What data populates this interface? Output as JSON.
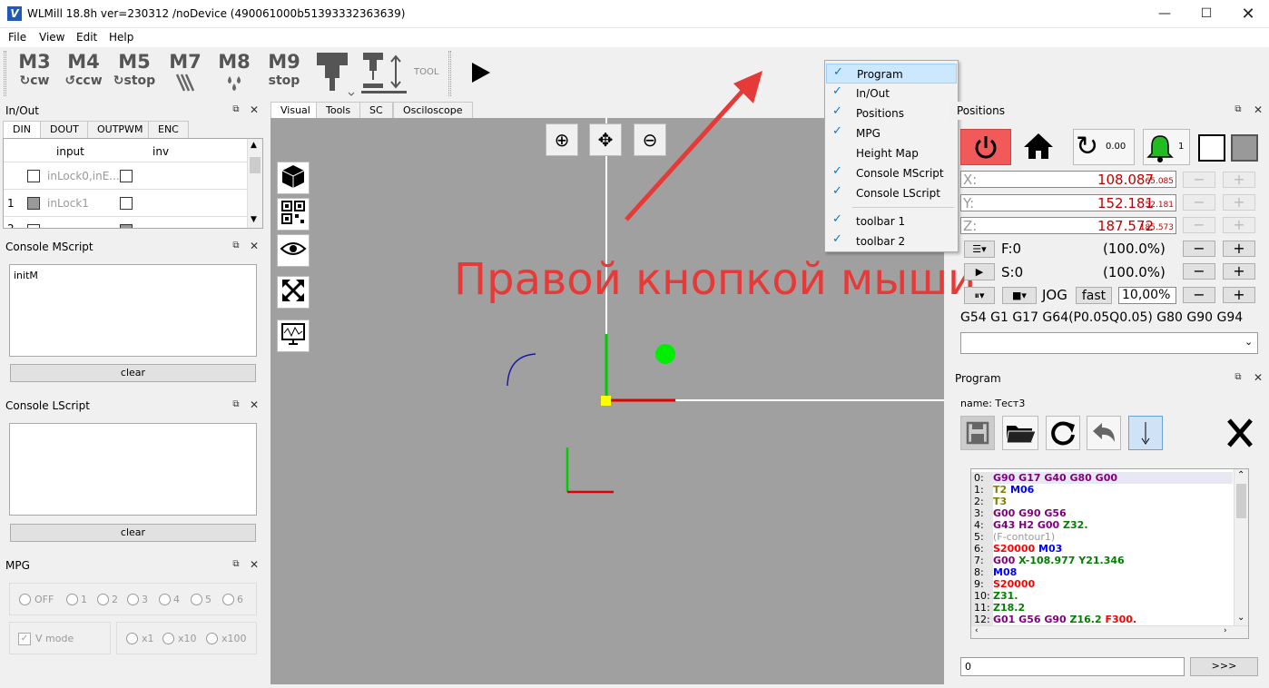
{
  "window": {
    "title": "WLMill 18.8h ver=230312 /noDevice (490061000b51393332363639)",
    "app_icon": "V"
  },
  "menu": [
    "File",
    "View",
    "Edit",
    "Help"
  ],
  "toolbar": {
    "buttons": [
      {
        "code": "M3",
        "sub": "cw"
      },
      {
        "code": "M4",
        "sub": "ccw"
      },
      {
        "code": "M5",
        "sub": "stop"
      },
      {
        "code": "M7",
        "sub": ""
      },
      {
        "code": "M8",
        "sub": ""
      },
      {
        "code": "M9",
        "sub": "stop"
      }
    ],
    "tool_label": "TOOL"
  },
  "inout": {
    "title": "In/Out",
    "tabs": [
      "DIN",
      "DOUT",
      "OUTPWM",
      "ENC"
    ],
    "columns": [
      "input",
      "inv"
    ],
    "rows": [
      {
        "num": "",
        "name": "inLock0,inE..."
      },
      {
        "num": "1",
        "name": "inLock1"
      },
      {
        "num": "2",
        "name": ""
      }
    ]
  },
  "console_mscript": {
    "title": "Console MScript",
    "text": "initM",
    "clear_label": "clear"
  },
  "console_lscript": {
    "title": "Console LScript",
    "text": "",
    "clear_label": "clear"
  },
  "mpg": {
    "title": "MPG",
    "modes": [
      "OFF",
      "1",
      "2",
      "3",
      "4",
      "5",
      "6"
    ],
    "vmode_label": "V mode",
    "multipliers": [
      "x1",
      "x10",
      "x100"
    ]
  },
  "center_tabs": [
    "Visual",
    "Tools",
    "SC",
    "Osciloscope"
  ],
  "annotation": "Правой кнопкой мыши",
  "context_menu": {
    "items": [
      {
        "label": "Program",
        "checked": true
      },
      {
        "label": "In/Out",
        "checked": true
      },
      {
        "label": "Positions",
        "checked": true
      },
      {
        "label": "MPG",
        "checked": true
      },
      {
        "label": "Height Map",
        "checked": false
      },
      {
        "label": "Console MScript",
        "checked": true
      },
      {
        "label": "Console LScript",
        "checked": true
      },
      {
        "label": "toolbar 1",
        "checked": true
      },
      {
        "label": "toolbar 2",
        "checked": true
      }
    ]
  },
  "positions": {
    "title": "Positions",
    "rotate_value": "0.00",
    "bell_value": "1",
    "axes": [
      {
        "name": "X:",
        "value": "108.087",
        "sub": "65.085"
      },
      {
        "name": "Y:",
        "value": "152.181",
        "sub": "52.181"
      },
      {
        "name": "Z:",
        "value": "187.572",
        "sub": "185.573"
      }
    ],
    "feed_label": "F:0",
    "feed_percent": "(100.0%)",
    "spindle_label": "S:0",
    "spindle_percent": "(100.0%)",
    "jog_label": "JOG",
    "fast_label": "fast",
    "jog_percent": "10,00%",
    "gcodes": "G54 G1 G17 G64(P0.05Q0.05) G80 G90 G94",
    "minus": "−",
    "plus": "+"
  },
  "program": {
    "title": "Program",
    "name_line": "name: Тест3",
    "lines": [
      {
        "num": "0:",
        "parts": [
          {
            "t": "G90 G17 G40 G80 G00",
            "c": "#800080"
          }
        ]
      },
      {
        "num": "1:",
        "parts": [
          {
            "t": "T2 ",
            "c": "#808000"
          },
          {
            "t": "M06",
            "c": "#0000ff"
          }
        ]
      },
      {
        "num": "2:",
        "parts": [
          {
            "t": "T3",
            "c": "#808000"
          }
        ]
      },
      {
        "num": "3:",
        "parts": [
          {
            "t": "G00 G90 G56",
            "c": "#800080"
          }
        ]
      },
      {
        "num": "4:",
        "parts": [
          {
            "t": "G43 H2 G00 ",
            "c": "#800080"
          },
          {
            "t": "Z32.",
            "c": "#008000"
          }
        ]
      },
      {
        "num": "5:",
        "parts": [
          {
            "t": "(F-contour1)",
            "c": "#999999"
          }
        ]
      },
      {
        "num": "6:",
        "parts": [
          {
            "t": "S20000 ",
            "c": "#ff0000"
          },
          {
            "t": "M03",
            "c": "#0000ff"
          }
        ]
      },
      {
        "num": "7:",
        "parts": [
          {
            "t": "G00 ",
            "c": "#800080"
          },
          {
            "t": "X-108.977 Y21.346",
            "c": "#008000"
          }
        ]
      },
      {
        "num": "8:",
        "parts": [
          {
            "t": "M08",
            "c": "#0000ff"
          }
        ]
      },
      {
        "num": "9:",
        "parts": [
          {
            "t": "S20000",
            "c": "#ff0000"
          }
        ]
      },
      {
        "num": "10:",
        "parts": [
          {
            "t": "Z31.",
            "c": "#008000"
          }
        ]
      },
      {
        "num": "11:",
        "parts": [
          {
            "t": "Z18.2",
            "c": "#008000"
          }
        ]
      },
      {
        "num": "12:",
        "parts": [
          {
            "t": "G01 G56 G90 ",
            "c": "#800080"
          },
          {
            "t": "Z16.2 ",
            "c": "#008000"
          },
          {
            "t": "F300.",
            "c": "#ff0000"
          }
        ]
      }
    ],
    "line_input": "0",
    "go_label": ">>>"
  }
}
